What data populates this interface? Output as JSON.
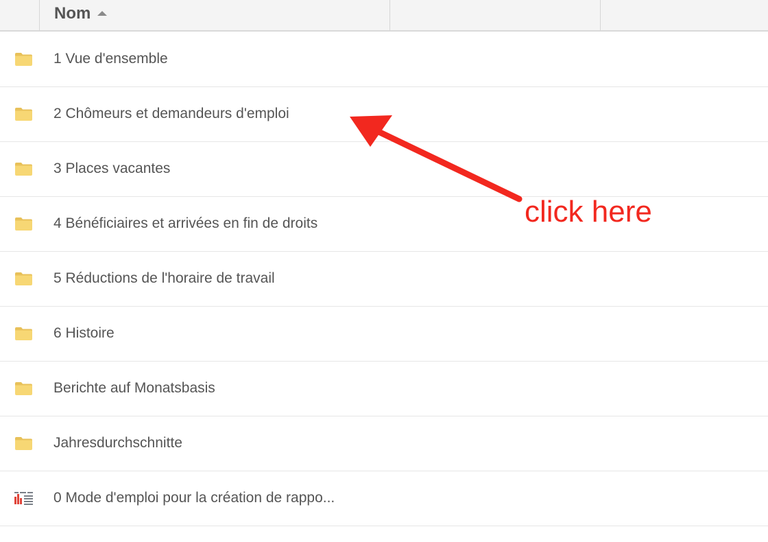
{
  "header": {
    "sort_label": "Nom",
    "sort_direction": "ascending",
    "sort_icon": "sort-ascending-icon"
  },
  "rows": [
    {
      "label": "1 Vue d'ensemble",
      "icon": "folder-icon"
    },
    {
      "label": "2 Chômeurs et demandeurs d'emploi",
      "icon": "folder-icon"
    },
    {
      "label": "3 Places vacantes",
      "icon": "folder-icon"
    },
    {
      "label": "4 Bénéficiaires et arrivées en fin de droits",
      "icon": "folder-icon"
    },
    {
      "label": "5 Réductions de l'horaire de travail",
      "icon": "folder-icon"
    },
    {
      "label": "6 Histoire",
      "icon": "folder-icon"
    },
    {
      "label": "Berichte auf Monatsbasis",
      "icon": "folder-icon"
    },
    {
      "label": "Jahresdurchschnitte",
      "icon": "folder-icon"
    },
    {
      "label": "0 Mode d'emploi pour la création de rappo...",
      "icon": "report-icon"
    }
  ],
  "annotation": {
    "text": "click here",
    "color": "#f2281f",
    "target": "2 Chômeurs et demandeurs d'emploi"
  },
  "colors": {
    "folder": "#f7d774",
    "folder_dark": "#e8c15a",
    "text": "#555555",
    "header_bg": "#f4f4f4",
    "report_red": "#e0453a",
    "report_gray": "#7a8088"
  }
}
